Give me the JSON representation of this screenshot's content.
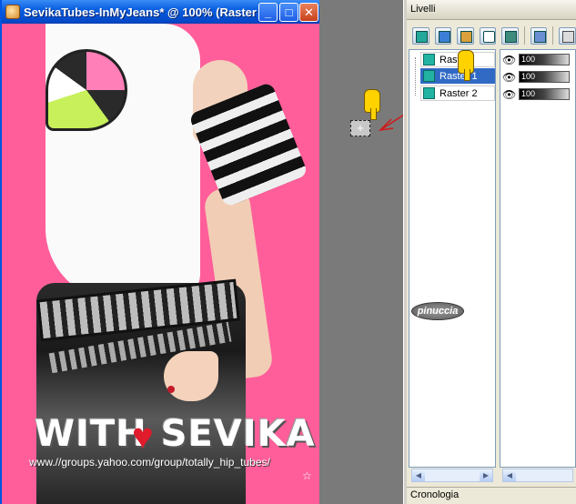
{
  "window": {
    "title": "SevikaTubes-InMyJeans* @ 100% (Raster",
    "buttons": {
      "minimize": "_",
      "maximize": "□",
      "close": "✕"
    }
  },
  "image": {
    "watermark_name": "WITH SEVIKA",
    "watermark_url": "www.//groups.yahoo.com/group/totally_hip_tubes/",
    "watermark_mark": "☆"
  },
  "palette": {
    "title": "Livelli",
    "layers": [
      {
        "label": "Raster"
      },
      {
        "label": "Raster 1"
      },
      {
        "label": "Raster 2"
      }
    ],
    "opacity": [
      {
        "value": "100"
      },
      {
        "value": "100"
      },
      {
        "value": "100"
      }
    ],
    "footer": "Cronologia",
    "signature": "pinuccia"
  },
  "colors": {
    "canvas_bg": "#ff5e9a",
    "selected_layer": "#316ac5",
    "pointer_arrow": "#d01a1a"
  }
}
